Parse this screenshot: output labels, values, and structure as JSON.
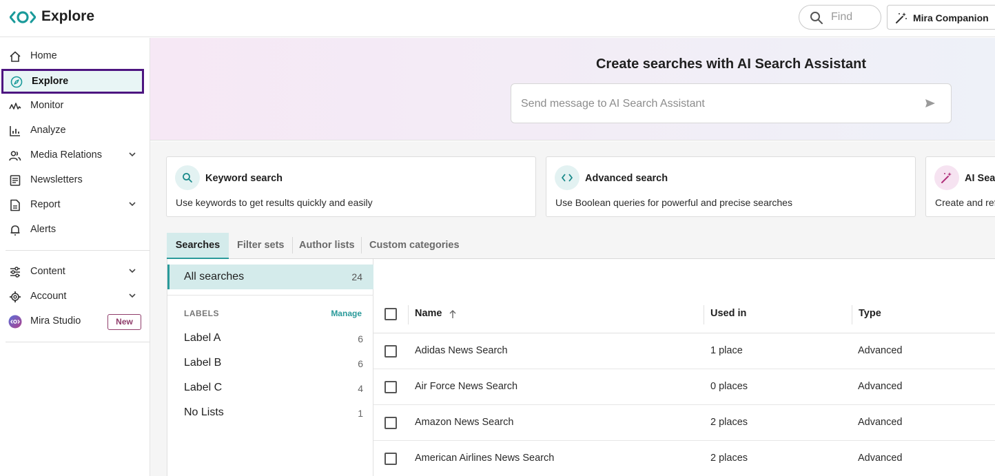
{
  "header": {
    "app_title": "Explore",
    "find_placeholder": "Find",
    "companion_label": "Mira Companion"
  },
  "sidebar": {
    "items": [
      {
        "label": "Home",
        "icon": "home-icon"
      },
      {
        "label": "Explore",
        "icon": "compass-icon",
        "active": true
      },
      {
        "label": "Monitor",
        "icon": "pulse-icon"
      },
      {
        "label": "Analyze",
        "icon": "bar-chart-icon"
      },
      {
        "label": "Media Relations",
        "icon": "people-icon",
        "expandable": true
      },
      {
        "label": "Newsletters",
        "icon": "newsletter-icon"
      },
      {
        "label": "Report",
        "icon": "report-icon",
        "expandable": true
      },
      {
        "label": "Alerts",
        "icon": "bell-icon"
      }
    ],
    "secondary": [
      {
        "label": "Content",
        "icon": "sliders-icon",
        "expandable": true
      },
      {
        "label": "Account",
        "icon": "gear-icon",
        "expandable": true
      },
      {
        "label": "Mira Studio",
        "icon": "mira-icon",
        "badge": "New"
      }
    ]
  },
  "hero": {
    "title": "Create searches with AI Search Assistant",
    "input_placeholder": "Send message to AI Search Assistant"
  },
  "cards": [
    {
      "title": "Keyword search",
      "desc": "Use keywords to get results quickly and easily"
    },
    {
      "title": "Advanced search",
      "desc": "Use Boolean queries for powerful and precise searches"
    },
    {
      "title": "AI Sear",
      "desc": "Create and ref"
    }
  ],
  "tabs": [
    "Searches",
    "Filter sets",
    "Author lists",
    "Custom categories"
  ],
  "left_panel": {
    "all_searches": {
      "label": "All searches",
      "count": "24"
    },
    "labels_heading": "LABELS",
    "manage": "Manage",
    "labels": [
      {
        "label": "Label A",
        "count": "6"
      },
      {
        "label": "Label B",
        "count": "6"
      },
      {
        "label": "Label C",
        "count": "4"
      },
      {
        "label": "No Lists",
        "count": "1"
      }
    ]
  },
  "table": {
    "columns": [
      "Name",
      "Used in",
      "Type"
    ],
    "rows": [
      {
        "name": "Adidas News Search",
        "used_in": "1 place",
        "type": "Advanced"
      },
      {
        "name": "Air Force News Search",
        "used_in": "0 places",
        "type": "Advanced"
      },
      {
        "name": "Amazon News Search",
        "used_in": "2 places",
        "type": "Advanced"
      },
      {
        "name": "American Airlines News Search",
        "used_in": "2 places",
        "type": "Advanced"
      }
    ]
  },
  "colors": {
    "accent": "#2a9a9a",
    "active_outline": "#4d1580",
    "badge": "#8f3c6a"
  }
}
